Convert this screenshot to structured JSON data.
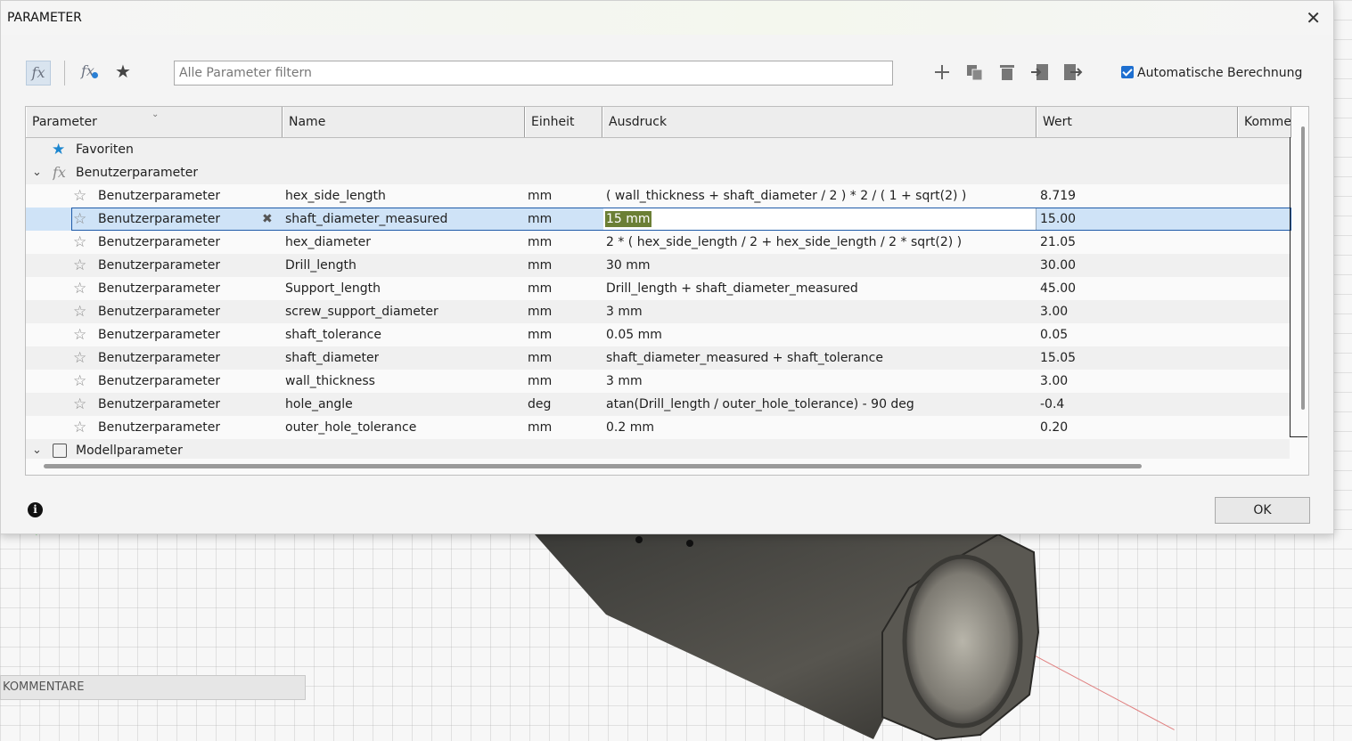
{
  "window": {
    "title": "PARAMETER",
    "close_symbol": "✕"
  },
  "toolbar": {
    "fx_symbol": "fx",
    "fx_user_symbol": "fx",
    "filter_placeholder": "Alle Parameter filtern",
    "auto_calc_label": "Automatische Berechnung",
    "auto_calc_checked": true,
    "icons": [
      "add-icon",
      "copy-icon",
      "delete-icon",
      "import-icon",
      "export-icon"
    ]
  },
  "table": {
    "headers": [
      "Parameter",
      "Name",
      "Einheit",
      "Ausdruck",
      "Wert",
      "Komme"
    ],
    "favorites_label": "Favoriten",
    "user_group_label": "Benutzerparameter",
    "model_group_label": "Modellparameter",
    "rows": [
      {
        "category": "Benutzerparameter",
        "name": "hex_side_length",
        "unit": "mm",
        "expression": "( wall_thickness + shaft_diameter / 2 ) * 2 / ( 1 + sqrt(2) )",
        "value": "8.719"
      },
      {
        "category": "Benutzerparameter",
        "name": "shaft_diameter_measured",
        "unit": "mm",
        "expression": "15 mm",
        "value": "15.00",
        "selected": true
      },
      {
        "category": "Benutzerparameter",
        "name": "hex_diameter",
        "unit": "mm",
        "expression": "2 * ( hex_side_length / 2 + hex_side_length / 2 * sqrt(2) )",
        "value": "21.05"
      },
      {
        "category": "Benutzerparameter",
        "name": "Drill_length",
        "unit": "mm",
        "expression": "30 mm",
        "value": "30.00"
      },
      {
        "category": "Benutzerparameter",
        "name": "Support_length",
        "unit": "mm",
        "expression": "Drill_length + shaft_diameter_measured",
        "value": "45.00"
      },
      {
        "category": "Benutzerparameter",
        "name": "screw_support_diameter",
        "unit": "mm",
        "expression": "3 mm",
        "value": "3.00"
      },
      {
        "category": "Benutzerparameter",
        "name": "shaft_tolerance",
        "unit": "mm",
        "expression": "0.05 mm",
        "value": "0.05"
      },
      {
        "category": "Benutzerparameter",
        "name": "shaft_diameter",
        "unit": "mm",
        "expression": "shaft_diameter_measured + shaft_tolerance",
        "value": "15.05"
      },
      {
        "category": "Benutzerparameter",
        "name": "wall_thickness",
        "unit": "mm",
        "expression": "3 mm",
        "value": "3.00"
      },
      {
        "category": "Benutzerparameter",
        "name": "hole_angle",
        "unit": "deg",
        "expression": "atan(Drill_length / outer_hole_tolerance) - 90 deg",
        "value": "-0.4"
      },
      {
        "category": "Benutzerparameter",
        "name": "outer_hole_tolerance",
        "unit": "mm",
        "expression": "0.2 mm",
        "value": "0.20"
      }
    ]
  },
  "footer": {
    "ok_label": "OK",
    "info_symbol": "i"
  },
  "background": {
    "comments_label": "KOMMENTARE"
  },
  "colors": {
    "accent": "#1e6fd0",
    "selection": "#cfe3f7",
    "edit_highlight": "#6b7f35",
    "star": "#1b86cf"
  }
}
